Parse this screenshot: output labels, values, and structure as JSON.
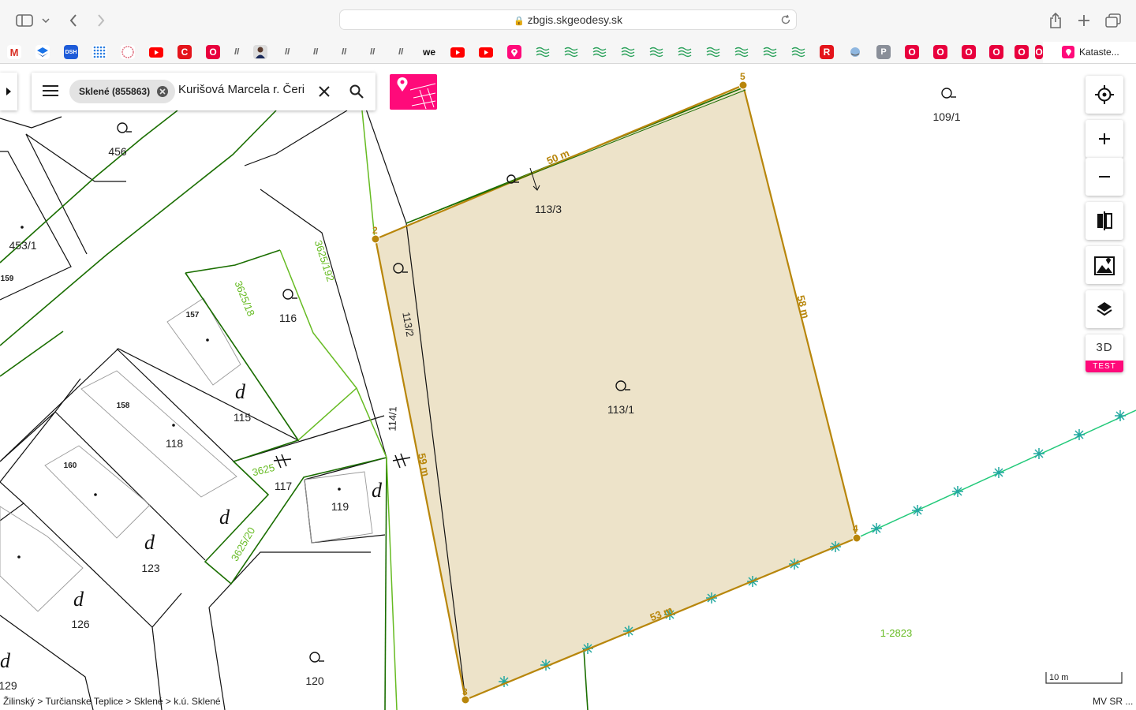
{
  "browser": {
    "url": "zbgis.skgeodesy.sk",
    "bookmark_tab_label": "Kataste..."
  },
  "search": {
    "chip_label": "Sklené (855863)",
    "query_text": "Kurišová Marcela r. Čeri"
  },
  "map": {
    "parcels": {
      "p456": "456",
      "p453_1": "453/1",
      "p159": "159",
      "p3625_192": "3625/192",
      "p3625_18": "3625/18",
      "p116": "116",
      "p157": "157",
      "p115": "115",
      "p158": "158",
      "p118": "118",
      "p160": "160",
      "p3625": "3625",
      "p117": "117",
      "p119": "119",
      "p3625_20": "3625/20",
      "p123": "123",
      "p126": "126",
      "p129": "129",
      "p120": "120",
      "p113_3": "113/3",
      "p113_2": "113/2",
      "p114_1": "114/1",
      "p113_1": "113/1",
      "p109_1": "109/1",
      "p1_2823": "1-2823"
    },
    "vertex_numbers": {
      "v2": "2",
      "v3": "3",
      "v4": "4",
      "v5": "5"
    },
    "dimensions": {
      "top": "50 m",
      "right": "58 m",
      "bottom": "53 m",
      "left": "59 m"
    },
    "scale_label": "10 m",
    "breadcrumb": "Žilinský > Turčianske Teplice > Sklené > k.ú. Sklené",
    "attribution": "MV SR ..."
  },
  "controls": {
    "three_d_label": "3D",
    "test_badge": "TEST"
  },
  "colors": {
    "parcel_fill": "#ede3c9",
    "parcel_outline": "#b8860b",
    "light_green": "#66bb22",
    "dark_green": "#1a6e00",
    "utility_line": "#22c97a",
    "accent_pink": "#ff0a7a"
  }
}
